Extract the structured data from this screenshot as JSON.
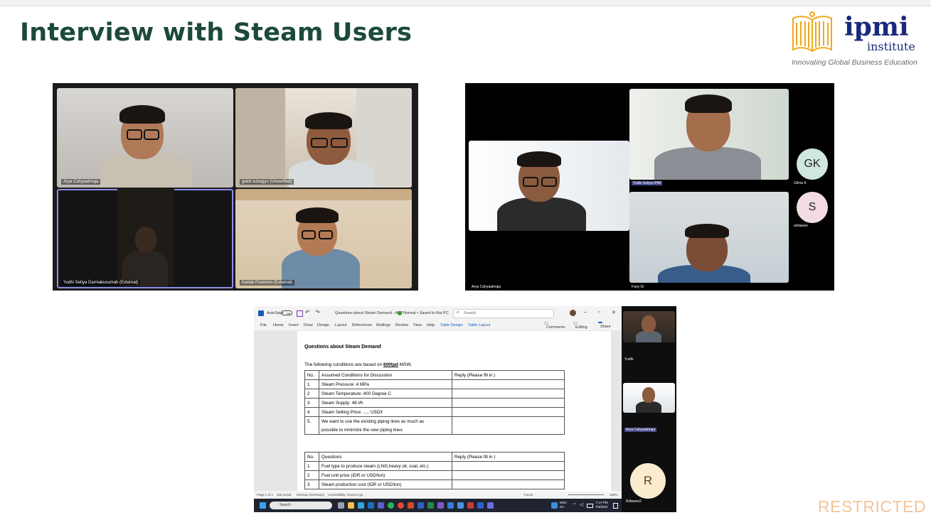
{
  "slide": {
    "title": "Interview with Steam Users",
    "logo": {
      "brand": "ipmi",
      "brand_sub": "institute",
      "tagline": "Innovating Global Business Education"
    },
    "restricted_label": "RESTRICTED"
  },
  "meeting1": {
    "participants": [
      {
        "name": "Arya Cahyaatmaja"
      },
      {
        "name": "gatot subagyo (Unverified)"
      },
      {
        "name": "Yudhi Setiya Darmakusumah (External)"
      },
      {
        "name": "Kartak Pramono (External)"
      }
    ]
  },
  "meeting2": {
    "participants": [
      {
        "name": "Arya Cahyaatmaja"
      },
      {
        "name": "Yudhi Setiya IPMI"
      },
      {
        "name": "Fany Dr"
      }
    ],
    "avatars": [
      {
        "initials": "GK",
        "name": "Gilma K",
        "color": "#cfe7dc"
      },
      {
        "initials": "S",
        "name": "setiawan",
        "color": "#f2dbe2"
      }
    ]
  },
  "word": {
    "titlebar": {
      "autosave": "AutoSave",
      "autosave_state": "Off",
      "doc_name": "Questions about Steam Demand - APP",
      "doc_status": "Normal • Saved to this PC",
      "search": "Search"
    },
    "ribbon_tabs": [
      "File",
      "Home",
      "Insert",
      "Draw",
      "Design",
      "Layout",
      "References",
      "Mailings",
      "Review",
      "View",
      "Help",
      "Table Design",
      "Table Layout"
    ],
    "ribbon_buttons": {
      "comments": "Comments",
      "editing": "Editing",
      "share": "Share"
    },
    "heading": "Questions about Steam Demand",
    "conditions_prefix": "The following conditions are based on ",
    "conditions_value": "600tpd",
    "conditions_suffix": " MSW.",
    "table1": {
      "headers": [
        "No.",
        "Assumed Conditions for Discussion",
        "Reply (Please fill in )"
      ],
      "rows": [
        [
          "1",
          "Steam Pressure: 4 MPa",
          ""
        ],
        [
          "2",
          "Steam Temperature: 400 Degree C",
          ""
        ],
        [
          "3",
          "Steam Supply: 46 t/h",
          ""
        ],
        [
          "4",
          "Steam Selling Price: ..... USD/t",
          ""
        ],
        [
          "5.",
          "We want to use the existing piping lines as much as",
          ""
        ],
        [
          "",
          "possible to minimize the new piping lines",
          ""
        ]
      ]
    },
    "table2": {
      "headers": [
        "No.",
        "Questions",
        "Reply (Please fill in )"
      ],
      "rows": [
        [
          "1",
          "Fuel type to produce steam (LNG,heavy oil, coal, etc.)",
          ""
        ],
        [
          "2",
          "Fuel unit price (IDR or USD/ton)",
          ""
        ],
        [
          "3",
          "Steam production cost (IDR or USD/ton)",
          ""
        ]
      ]
    },
    "status": {
      "page": "Page 1 of 1",
      "words": "235 words",
      "language": "German (Germany)",
      "accessibility": "Accessibility: Good to go",
      "focus": "Focus",
      "zoom": "150%"
    },
    "taskbar": {
      "search": "Search",
      "lang": "ENG",
      "lang2": "DV",
      "time": "7:47 PM",
      "date": "7/3/2024"
    },
    "side_participants": [
      {
        "name": "Yudhi"
      },
      {
        "name": "Arya Cahyaatmaja"
      },
      {
        "name": "Ridwanz2",
        "initials": "R"
      }
    ]
  }
}
